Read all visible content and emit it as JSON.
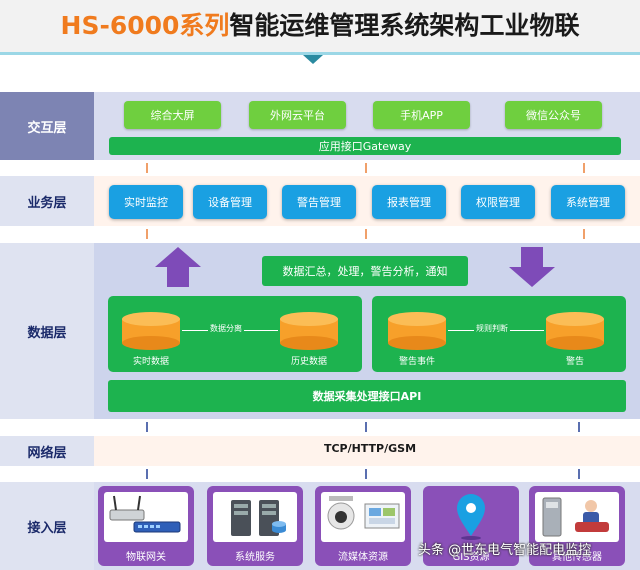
{
  "title": {
    "part1": "HS-6000系列",
    "part2": "智能运维管理系统架构",
    "part3": "工业物联"
  },
  "layers": {
    "interaction": {
      "label": "交互层",
      "items": [
        "综合大屏",
        "外网云平台",
        "手机APP",
        "微信公众号"
      ],
      "gateway": "应用接口Gateway"
    },
    "business": {
      "label": "业务层",
      "items": [
        "实时监控",
        "设备管理",
        "警告管理",
        "报表管理",
        "权限管理",
        "系统管理"
      ]
    },
    "data": {
      "label": "数据层",
      "summary": "数据汇总，处理，警告分析，通知",
      "left_panel": {
        "db1": "实时数据",
        "db2": "历史数据",
        "link": "数据分离"
      },
      "right_panel": {
        "db1": "警告事件",
        "db2": "警告",
        "link": "规则判断"
      },
      "api": "数据采集处理接口API"
    },
    "network": {
      "label": "网络层",
      "protocol": "TCP/HTTP/GSM"
    },
    "access": {
      "label": "接入层",
      "items": [
        "物联网关",
        "系统服务",
        "流媒体资源",
        "GIS资源",
        "其他传感器"
      ]
    }
  },
  "watermark": "头条 @世东电气智能配电监控",
  "colors": {
    "orange_title": "#f07b1e",
    "green": "#1db34f",
    "light_green": "#6fcf3f",
    "blue": "#1aa0e2",
    "purple": "#8a50b8",
    "label_bg": "#7d84b3"
  }
}
